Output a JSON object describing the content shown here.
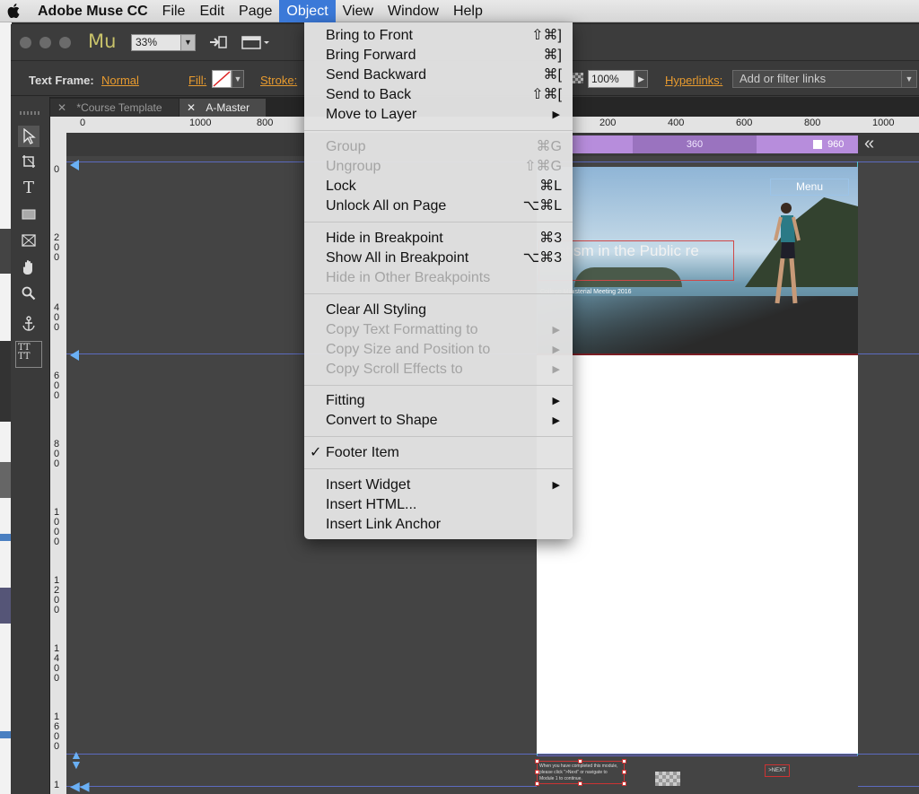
{
  "menubar": {
    "app": "Adobe Muse CC",
    "items": [
      "File",
      "Edit",
      "Page",
      "Object",
      "View",
      "Window",
      "Help"
    ],
    "selected": "Object"
  },
  "toolbar": {
    "logo": "Mu",
    "zoom": "33%"
  },
  "options": {
    "text_frame_label": "Text Frame:",
    "text_frame_value": "Normal",
    "fill_label": "Fill:",
    "stroke_label": "Stroke:",
    "opacity": "100%",
    "hyperlinks_label": "Hyperlinks:",
    "hyperlinks_placeholder": "Add or filter links"
  },
  "tabs": [
    "*Course Template",
    "A-Master"
  ],
  "ruler": {
    "h_left": [
      "0",
      "1000",
      "800"
    ],
    "h_right": [
      "200",
      "400",
      "600",
      "800",
      "1000"
    ],
    "v": [
      "0",
      "200",
      "400",
      "600",
      "800",
      "1000",
      "1200",
      "1400",
      "1600",
      "1"
    ]
  },
  "breakpoints": {
    "mid": "360",
    "max": "960"
  },
  "page": {
    "menu_button": "Menu",
    "hero_title": "ntism in the Public re",
    "hero_subtitle": "College Ministerial Meeting 2016",
    "footer_note": "When you have completed this module, please click \">Next\" or navigate to Module 1 to continue.",
    "next_label": ">NEXT"
  },
  "object_menu": {
    "items": [
      {
        "label": "Bring to Front",
        "shortcut": "⇧⌘]",
        "enabled": true
      },
      {
        "label": "Bring Forward",
        "shortcut": "⌘]",
        "enabled": true
      },
      {
        "label": "Send Backward",
        "shortcut": "⌘[",
        "enabled": true
      },
      {
        "label": "Send to Back",
        "shortcut": "⇧⌘[",
        "enabled": true
      },
      {
        "label": "Move to Layer",
        "submenu": true,
        "enabled": true
      },
      {
        "label": "Group",
        "shortcut": "⌘G",
        "enabled": false
      },
      {
        "label": "Ungroup",
        "shortcut": "⇧⌘G",
        "enabled": false
      },
      {
        "label": "Lock",
        "shortcut": "⌘L",
        "enabled": true
      },
      {
        "label": "Unlock All on Page",
        "shortcut": "⌥⌘L",
        "enabled": true
      },
      {
        "label": "Hide in Breakpoint",
        "shortcut": "⌘3",
        "enabled": true
      },
      {
        "label": "Show All in Breakpoint",
        "shortcut": "⌥⌘3",
        "enabled": true
      },
      {
        "label": "Hide in Other Breakpoints",
        "enabled": false
      },
      {
        "label": "Clear All Styling",
        "enabled": true
      },
      {
        "label": "Copy Text Formatting to",
        "submenu": true,
        "enabled": false
      },
      {
        "label": "Copy Size and Position to",
        "submenu": true,
        "enabled": false
      },
      {
        "label": "Copy Scroll Effects to",
        "submenu": true,
        "enabled": false
      },
      {
        "label": "Fitting",
        "submenu": true,
        "enabled": true
      },
      {
        "label": "Convert to Shape",
        "submenu": true,
        "enabled": true
      },
      {
        "label": "Footer Item",
        "checked": true,
        "enabled": true
      },
      {
        "label": "Insert Widget",
        "submenu": true,
        "enabled": true
      },
      {
        "label": "Insert HTML...",
        "enabled": true
      },
      {
        "label": "Insert Link Anchor",
        "enabled": true
      }
    ]
  },
  "colors": {
    "accent_orange": "#e89b2f",
    "menu_selection": "#3b79d8",
    "breakpoint_bar": "#b78ddc"
  }
}
